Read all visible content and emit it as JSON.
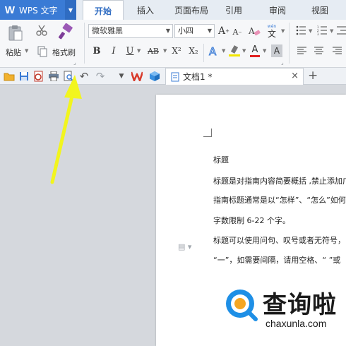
{
  "app": {
    "title": "WPS 文字",
    "logo_letter": "W",
    "accent_color": "#3a7bd5"
  },
  "tabs": [
    {
      "label": "开始",
      "active": true
    },
    {
      "label": "插入",
      "active": false
    },
    {
      "label": "页面布局",
      "active": false
    },
    {
      "label": "引用",
      "active": false
    },
    {
      "label": "审阅",
      "active": false
    },
    {
      "label": "视图",
      "active": false
    }
  ],
  "ribbon": {
    "paste_label": "粘贴",
    "format_painter_label": "格式刷",
    "font_name": "微软雅黑",
    "font_size": "小四",
    "bold": "B",
    "italic": "I",
    "underline": "U",
    "strikethrough": "AB",
    "superscript": "X²",
    "subscript": "X₂",
    "phonetic": "wén",
    "phonetic_char": "文"
  },
  "document": {
    "tab_name": "文档1 *",
    "lines": [
      "标题",
      "标题是对指南内容简要概括 ,禁止添加广告",
      "指南标题通常是以“怎样”、“怎么”如何",
      "字数限制 6-22 个字。",
      "标题可以使用问句、叹号或者无符号，",
      "“一”，如需要间隔，请用空格、“ ”或"
    ]
  },
  "watermark": {
    "title": "查询啦",
    "url": "chaxunla.com"
  },
  "colors": {
    "arrow": "#f2f51e",
    "workspace": "#d5d8dd",
    "active_tab_text": "#2f6cc2"
  }
}
